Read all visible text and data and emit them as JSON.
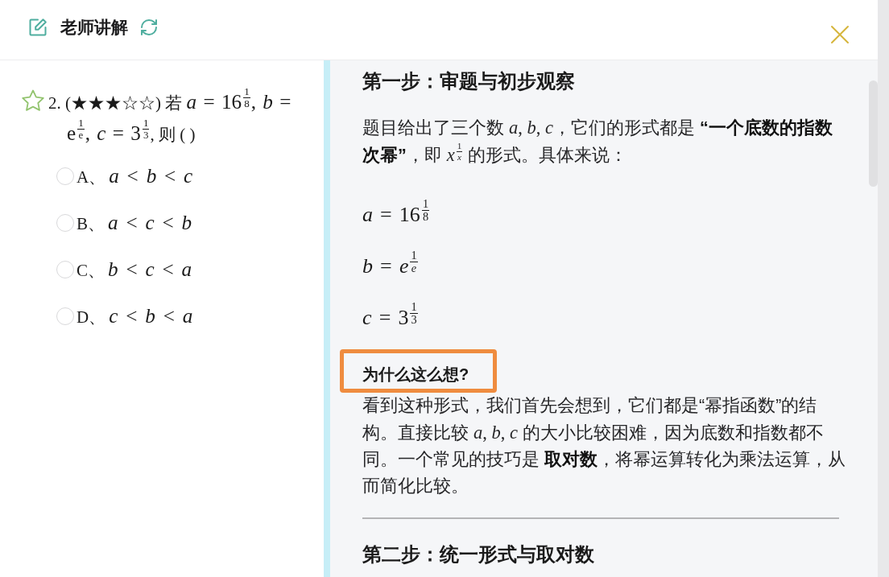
{
  "header": {
    "title": "老师讲解"
  },
  "question": {
    "starred": false,
    "segments": [
      {
        "kind": "text",
        "text": "2. (★★★☆☆) 若 "
      },
      {
        "kind": "math",
        "text": "*a* = 16"
      },
      {
        "kind": "frac",
        "num": "1",
        "den": "8"
      },
      {
        "kind": "math",
        "text": ", *b* = "
      },
      {
        "kind": "math",
        "text": "e"
      },
      {
        "kind": "frac",
        "num": "1",
        "den": "e"
      },
      {
        "kind": "math",
        "text": ", *c* = 3"
      },
      {
        "kind": "frac",
        "num": "1",
        "den": "3"
      },
      {
        "kind": "text",
        "text": ", 则 ( )"
      }
    ]
  },
  "options": [
    {
      "label": "A、",
      "math": "*a* < *b* < *c*",
      "selected": false
    },
    {
      "label": "B、",
      "math": "*a* < *c* < *b*",
      "selected": false
    },
    {
      "label": "C、",
      "math": "*b* < *c* < *a*",
      "selected": false
    },
    {
      "label": "D、",
      "math": "*c* < *b* < *a*",
      "selected": false
    }
  ],
  "explanation": {
    "blocks": [
      {
        "kind": "heading",
        "text": "第一步：审题与初步观察"
      },
      {
        "kind": "paragraph",
        "segments": [
          {
            "kind": "text",
            "text": "题目给出了三个数 "
          },
          {
            "kind": "math",
            "text": "*a*, *b*, *c*"
          },
          {
            "kind": "text",
            "text": "，它们的形式都是 **“一个底数的指数次幂”**，即 "
          },
          {
            "kind": "math",
            "text": "*x*"
          },
          {
            "kind": "frac",
            "num": "1",
            "den": "*x*"
          },
          {
            "kind": "text",
            "text": " 的形式。具体来说："
          }
        ]
      },
      {
        "kind": "formula",
        "segments": [
          {
            "kind": "math",
            "text": "*a* = 16"
          },
          {
            "kind": "frac",
            "num": "1",
            "den": "8"
          }
        ]
      },
      {
        "kind": "formula",
        "segments": [
          {
            "kind": "math",
            "text": "*b* = *e*"
          },
          {
            "kind": "frac",
            "num": "1",
            "den": "*e*"
          }
        ]
      },
      {
        "kind": "formula",
        "segments": [
          {
            "kind": "math",
            "text": "*c* = 3"
          },
          {
            "kind": "frac",
            "num": "1",
            "den": "3"
          }
        ]
      },
      {
        "kind": "subheading",
        "text": "为什么这么想?",
        "highlighted": true
      },
      {
        "kind": "paragraph",
        "segments": [
          {
            "kind": "text",
            "text": "看到这种形式，我们首先会想到，它们都是“幂指函数”的结构。直接比较 "
          },
          {
            "kind": "math",
            "text": "*a*, *b*, *c*"
          },
          {
            "kind": "text",
            "text": " 的大小比较困难，因为底数和指数都不同。一个常见的技巧是 **取对数**，将幂运算转化为乘法运算，从而简化比较。"
          }
        ]
      },
      {
        "kind": "divider"
      },
      {
        "kind": "heading",
        "text": "第二步：统一形式与取对数"
      }
    ]
  }
}
